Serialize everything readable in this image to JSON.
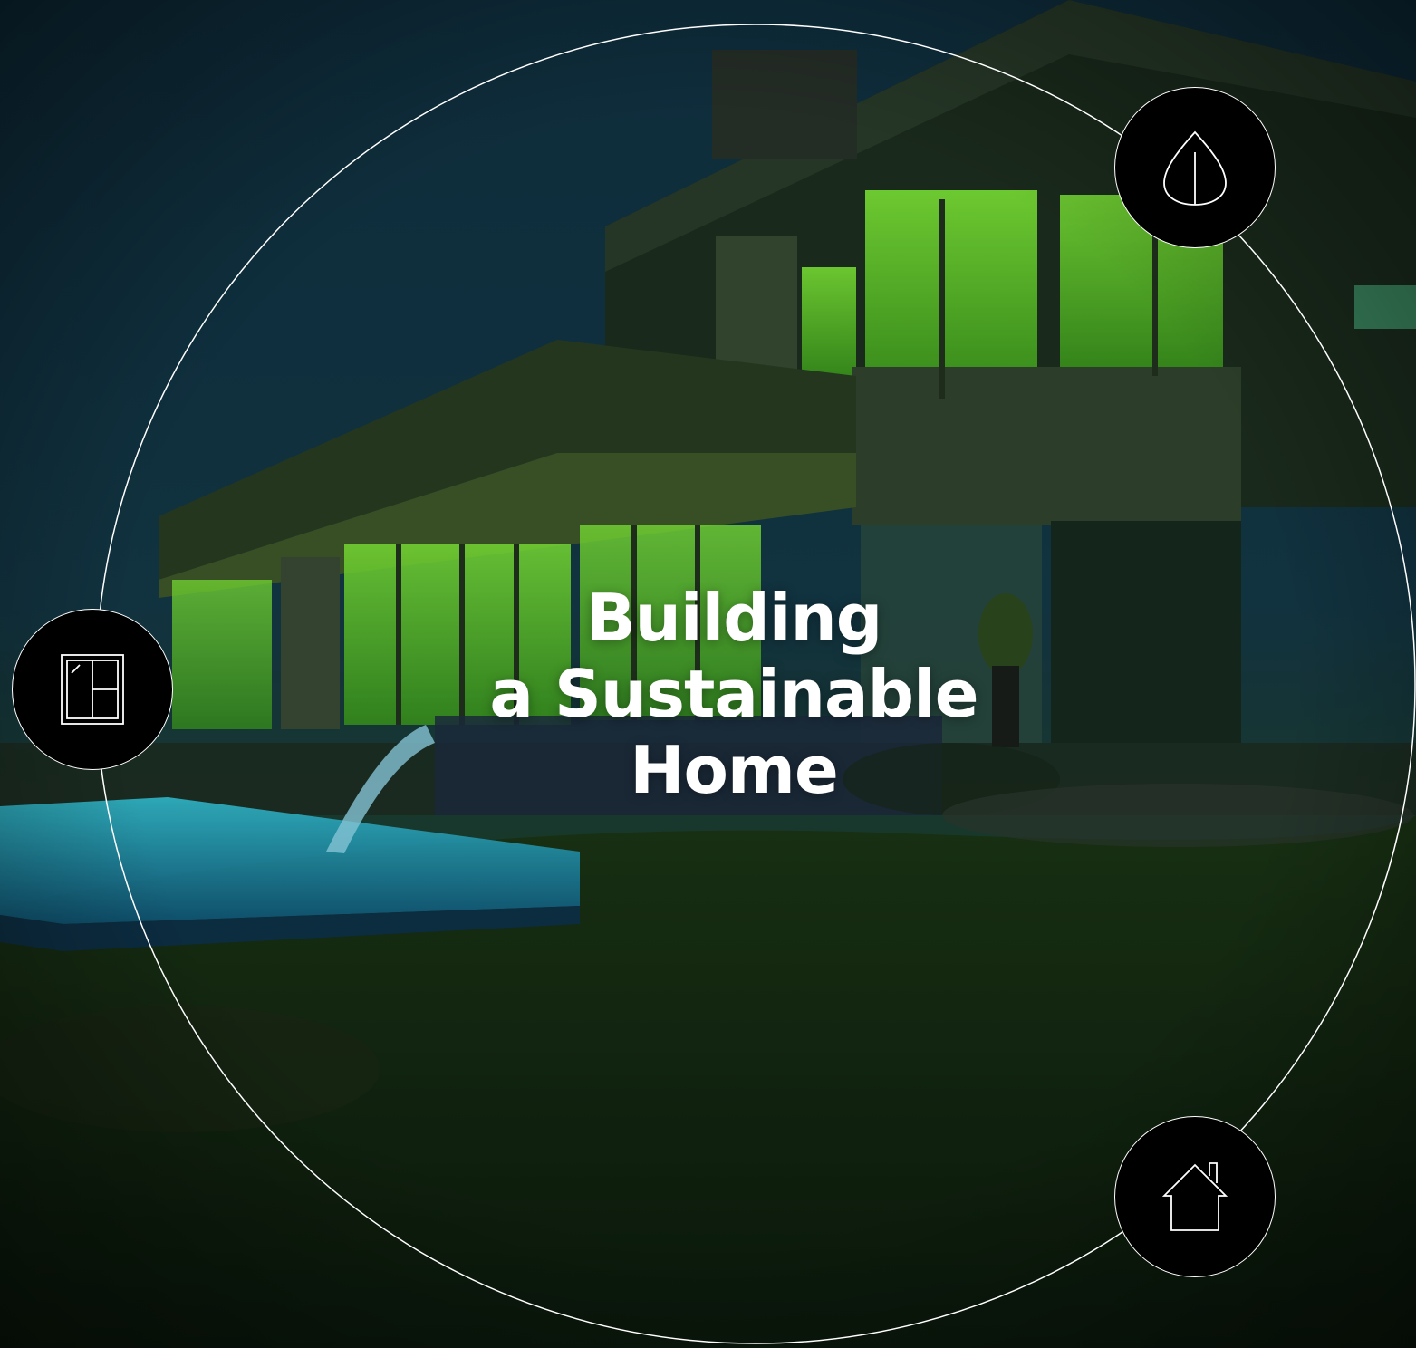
{
  "hero": {
    "title_lines": [
      "Building",
      "a Sustainable",
      "Home"
    ]
  },
  "icons": {
    "leaf": "leaf-icon",
    "window": "window-icon",
    "house": "house-icon"
  },
  "colors": {
    "line": "#ffffff",
    "badge_fill": "#000000",
    "glow_green": "#7cff2b",
    "pool_cyan": "#22c7e6"
  }
}
